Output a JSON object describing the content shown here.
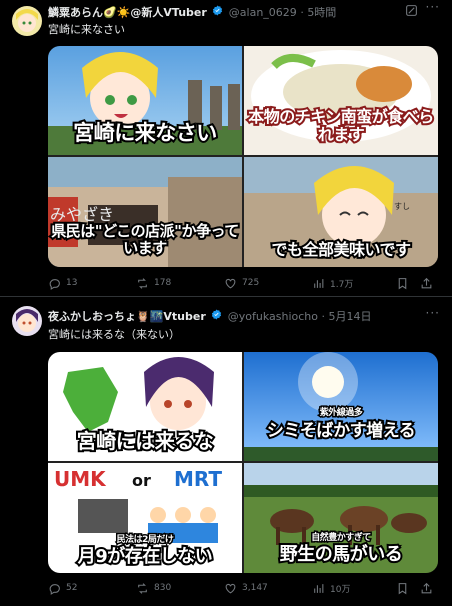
{
  "tweets": [
    {
      "author": "鱗粟あらん🥑☀️@新人VTuber",
      "handle": "@alan_0629",
      "time": "5時間",
      "text": "宮崎に来なさい",
      "captions": [
        "宮崎に来なさい",
        "本物のチキン南蛮が食べられます",
        "県民は\"どこの店派\"か争っています",
        "でも全部美味いです"
      ],
      "sign": "みやざき",
      "store_sign": "すし",
      "stats": {
        "replies": "13",
        "retweets": "178",
        "likes": "725",
        "views": "1.7万"
      }
    },
    {
      "author": "夜ふかしおっちょ🦉🌃Vtuber",
      "handle": "@yofukashiocho",
      "time": "5月14日",
      "text": "宮崎には来るな（来ない）",
      "captions": [
        "宮崎には来るな",
        "シミそばかす増える",
        "月9が存在しない",
        "野生の馬がいる"
      ],
      "small_captions": [
        "紫外線過多",
        "民法は2局だけ",
        "自然豊かすぎて"
      ],
      "tv_labels": {
        "umk": "UMK",
        "or": "or",
        "mrt": "MRT"
      },
      "stats": {
        "replies": "52",
        "retweets": "830",
        "likes": "3,147",
        "views": "10万"
      }
    }
  ],
  "colors": {
    "bg": "#000000",
    "text": "#e7e9ea",
    "muted": "#71767b",
    "verified": "#1d9bf0",
    "separator": "#2f3336"
  }
}
